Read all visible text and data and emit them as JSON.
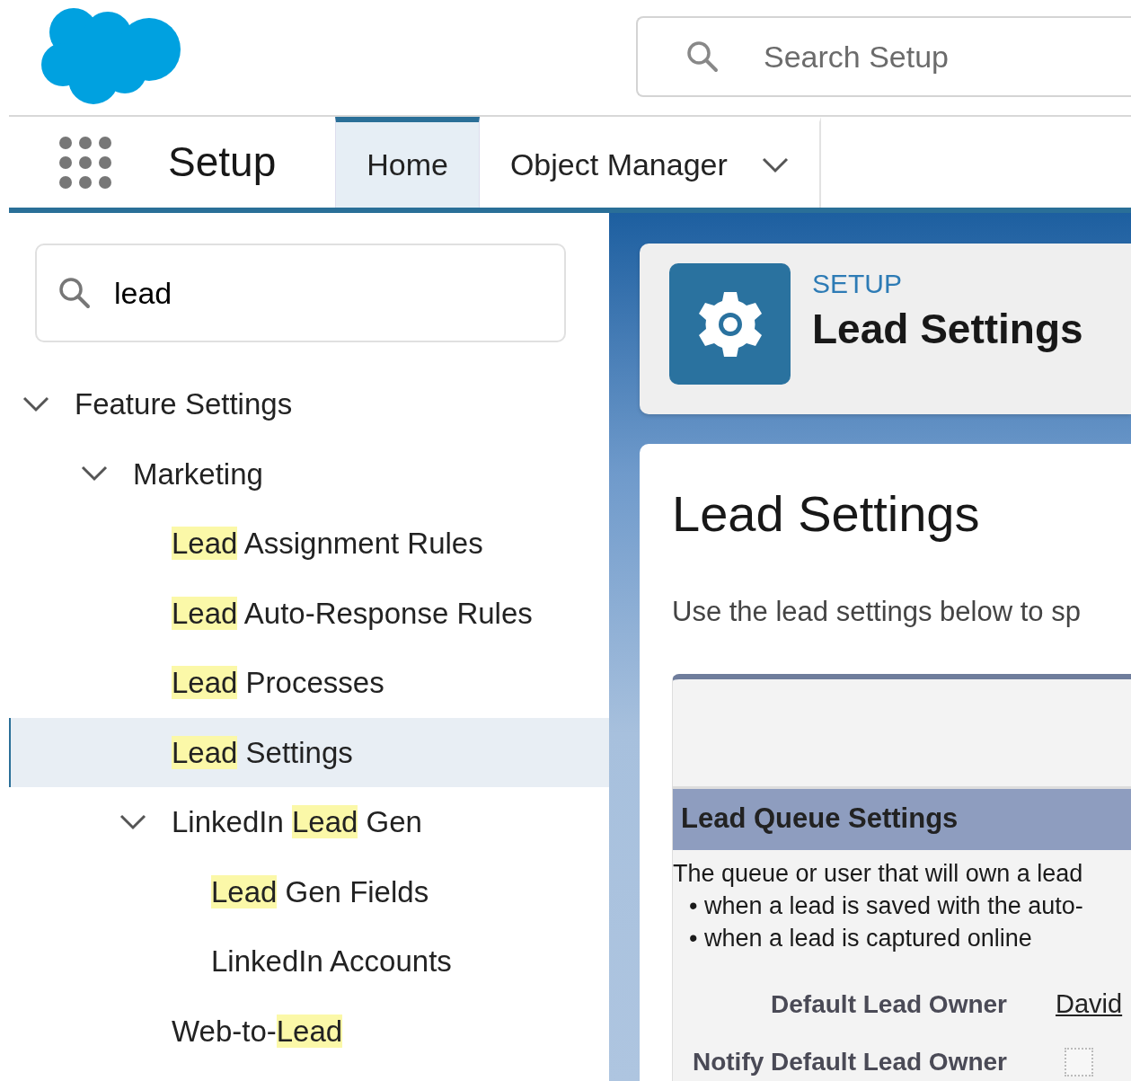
{
  "header": {
    "search": {
      "placeholder": "Search Setup"
    }
  },
  "nav": {
    "app_name": "Setup",
    "tabs": [
      {
        "label": "Home",
        "selected": true,
        "has_menu": false
      },
      {
        "label": "Object Manager",
        "selected": false,
        "has_menu": true
      }
    ]
  },
  "sidebar": {
    "search": {
      "value": "lead"
    },
    "tree": [
      {
        "segments": [
          {
            "text": "Feature Settings",
            "highlighted": false
          }
        ],
        "expanded": true,
        "selected": false,
        "children": [
          {
            "segments": [
              {
                "text": "Marketing",
                "highlighted": false
              }
            ],
            "expanded": true,
            "selected": false,
            "children": [
              {
                "segments": [
                  {
                    "text": "Lead",
                    "highlighted": true
                  },
                  {
                    "text": " Assignment Rules",
                    "highlighted": false
                  }
                ],
                "selected": false
              },
              {
                "segments": [
                  {
                    "text": "Lead",
                    "highlighted": true
                  },
                  {
                    "text": " Auto-Response Rules",
                    "highlighted": false
                  }
                ],
                "selected": false
              },
              {
                "segments": [
                  {
                    "text": "Lead",
                    "highlighted": true
                  },
                  {
                    "text": " Processes",
                    "highlighted": false
                  }
                ],
                "selected": false
              },
              {
                "segments": [
                  {
                    "text": "Lead",
                    "highlighted": true
                  },
                  {
                    "text": " Settings",
                    "highlighted": false
                  }
                ],
                "selected": true
              },
              {
                "segments": [
                  {
                    "text": "LinkedIn ",
                    "highlighted": false
                  },
                  {
                    "text": "Lead",
                    "highlighted": true
                  },
                  {
                    "text": " Gen",
                    "highlighted": false
                  }
                ],
                "expanded": true,
                "selected": false,
                "children": [
                  {
                    "segments": [
                      {
                        "text": "Lead",
                        "highlighted": true
                      },
                      {
                        "text": " Gen Fields",
                        "highlighted": false
                      }
                    ],
                    "selected": false
                  },
                  {
                    "segments": [
                      {
                        "text": "LinkedIn Accounts",
                        "highlighted": false
                      }
                    ],
                    "selected": false
                  }
                ]
              },
              {
                "segments": [
                  {
                    "text": "Web-to-",
                    "highlighted": false
                  },
                  {
                    "text": "Lead",
                    "highlighted": true
                  }
                ],
                "selected": false
              }
            ]
          }
        ]
      }
    ]
  },
  "page_header": {
    "eyebrow": "SETUP",
    "title": "Lead Settings"
  },
  "content": {
    "title": "Lead Settings",
    "description": "Use the lead settings below to sp",
    "section": {
      "title": "Lead Queue Settings",
      "text_lines": [
        "The queue or user that will own a lead",
        "• when a lead is saved with the auto-",
        "• when a lead is captured online"
      ],
      "fields": [
        {
          "kind": "link",
          "label": "Default Lead Owner",
          "value": "David"
        },
        {
          "kind": "checkbox",
          "label": "Notify Default Lead Owner",
          "checked": false
        }
      ]
    }
  }
}
